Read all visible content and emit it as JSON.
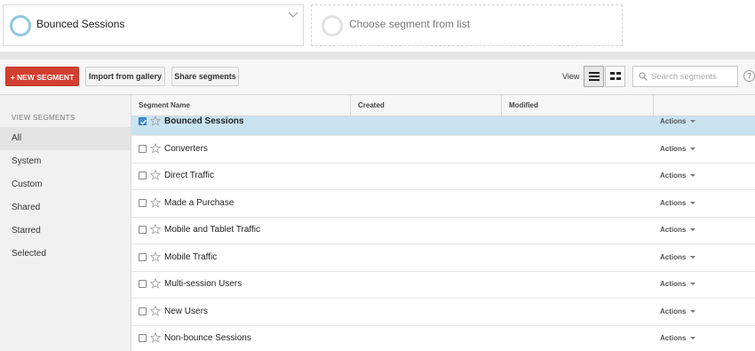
{
  "segment_slots": [
    {
      "label": "Bounced Sessions"
    },
    {
      "label": "Choose segment from list"
    }
  ],
  "toolbar": {
    "new_segment_label": "+ NEW SEGMENT",
    "import_label": "Import from gallery",
    "share_label": "Share segments",
    "view_label": "View",
    "search_placeholder": "Search segments",
    "help_label": "?"
  },
  "sidebar": {
    "heading": "VIEW SEGMENTS",
    "items": [
      {
        "label": "All"
      },
      {
        "label": "System"
      },
      {
        "label": "Custom"
      },
      {
        "label": "Shared"
      },
      {
        "label": "Starred"
      },
      {
        "label": "Selected"
      }
    ]
  },
  "table": {
    "columns": {
      "name": "Segment Name",
      "created": "Created",
      "modified": "Modified"
    },
    "actions_label": "Actions",
    "rows": [
      {
        "name": "Bounced Sessions",
        "checked": true
      },
      {
        "name": "Converters",
        "checked": false
      },
      {
        "name": "Direct Traffic",
        "checked": false
      },
      {
        "name": "Made a Purchase",
        "checked": false
      },
      {
        "name": "Mobile and Tablet Traffic",
        "checked": false
      },
      {
        "name": "Mobile Traffic",
        "checked": false
      },
      {
        "name": "Multi-session Users",
        "checked": false
      },
      {
        "name": "New Users",
        "checked": false
      },
      {
        "name": "Non-bounce Sessions",
        "checked": false
      }
    ]
  },
  "colors": {
    "accent_red": "#d23f31",
    "selected_row": "#c9e3f1",
    "ring_active": "#8fc7e0"
  }
}
